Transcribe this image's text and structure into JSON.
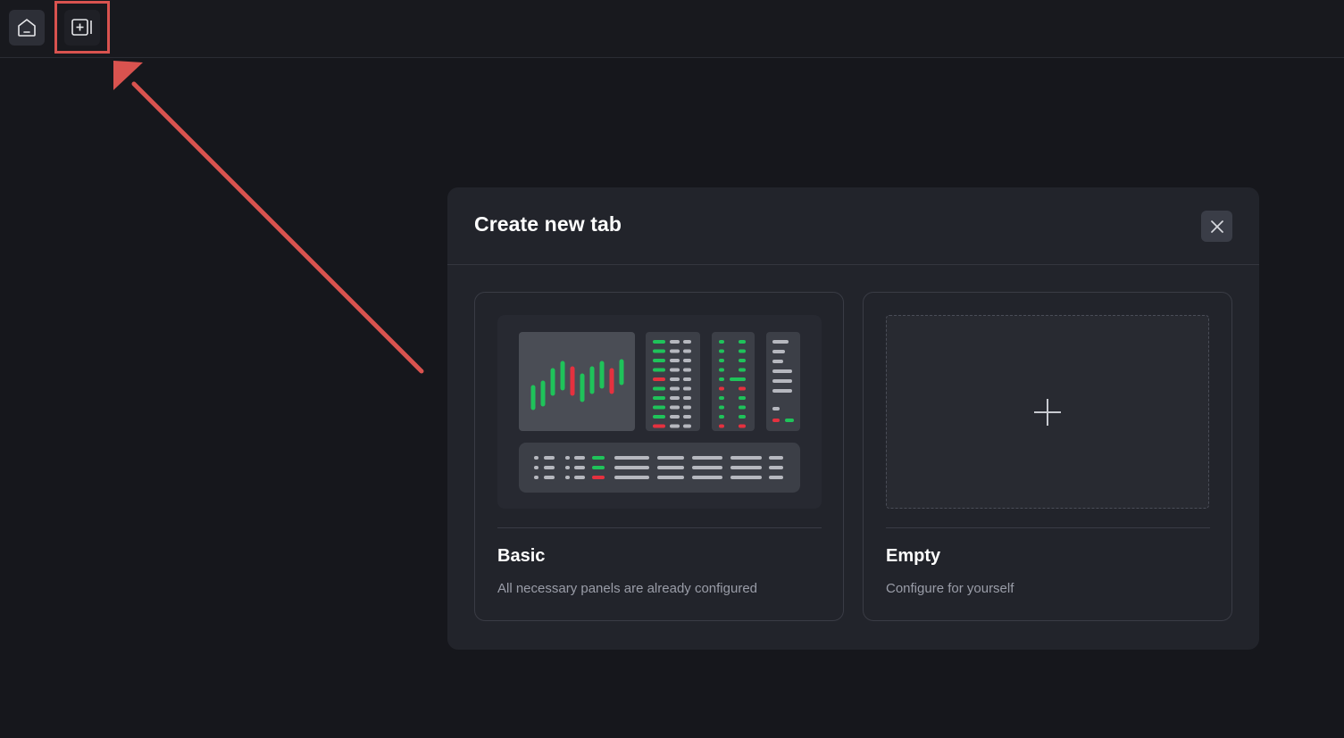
{
  "topbar": {
    "home_icon": "home-icon",
    "new_tab_icon": "add-panel-icon"
  },
  "modal": {
    "title": "Create new tab",
    "close_icon": "close-icon",
    "options": [
      {
        "title": "Basic",
        "description": "All necessary panels are already configured",
        "preview": "trading-layout-preview"
      },
      {
        "title": "Empty",
        "description": "Configure for yourself",
        "preview": "plus-icon"
      }
    ]
  },
  "colors": {
    "background": "#16171c",
    "modal_bg": "#22242b",
    "accent_green": "#1fc35a",
    "accent_red": "#e5313f",
    "annotation_red": "#d9534f"
  }
}
